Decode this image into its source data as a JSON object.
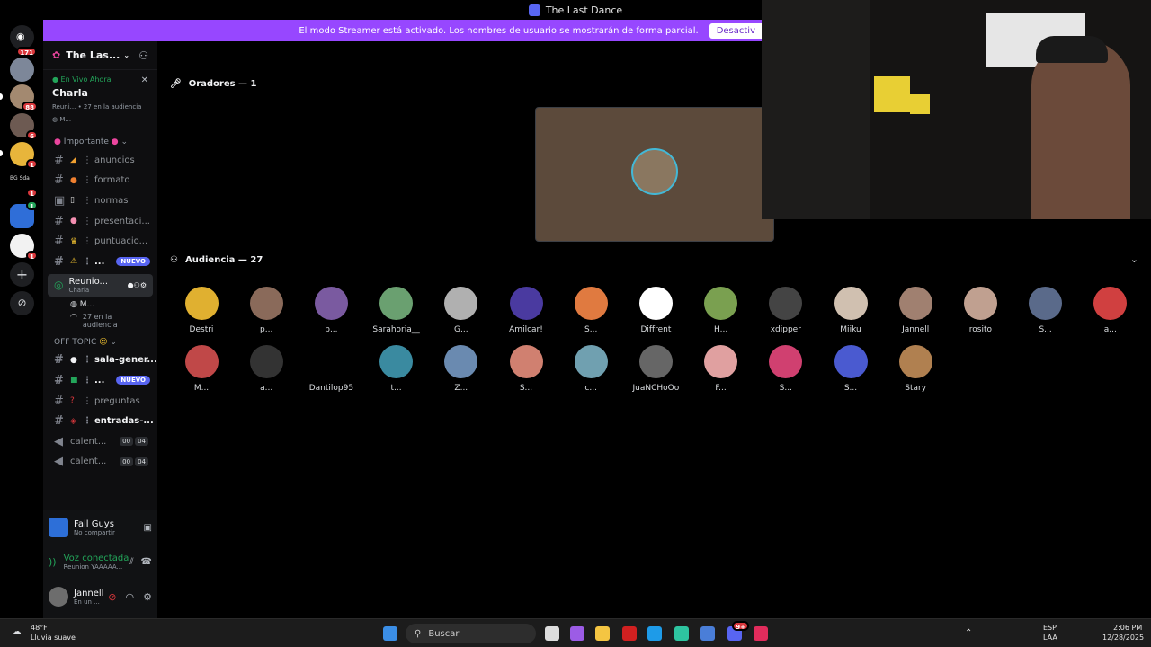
{
  "window": {
    "title": "The Last Dance"
  },
  "banner": {
    "message": "El modo Streamer está activado. Los nombres de usuario se mostrarán de forma parcial.",
    "button": "Desactiv"
  },
  "server_rail": {
    "badges": [
      "171",
      "88",
      "6",
      "1",
      "1",
      "1",
      "1"
    ],
    "folder_label": "BG Sda"
  },
  "sidebar": {
    "server_name": "The Las...",
    "live": {
      "status": "En Vivo Ahora",
      "channel": "Charla",
      "sub": "Reuni... • 27 en la audiencia",
      "user": "M..."
    },
    "categories": [
      "Importante",
      "OFF TOPIC"
    ],
    "channels": [
      {
        "name": "anuncios",
        "icon": "megaphone-emoji"
      },
      {
        "name": "formato",
        "icon": "pill-emoji"
      },
      {
        "name": "normas",
        "icon": "clipboard-emoji"
      },
      {
        "name": "presentaci...",
        "icon": "pig-emoji"
      },
      {
        "name": "puntuacio...",
        "icon": "crown-emoji"
      },
      {
        "name": "...",
        "icon": "warning-emoji",
        "badge": "NUEVO"
      }
    ],
    "stage": {
      "name": "Reunio...",
      "sub": "Charla",
      "user": "M...",
      "audience": "27 en la audiencia"
    },
    "offtopic_channels": [
      {
        "name": "sala-gener...",
        "icon": "speech-emoji",
        "bold": true
      },
      {
        "name": "...",
        "icon": "check-emoji",
        "badge": "NUEVO",
        "bold": true
      },
      {
        "name": "preguntas",
        "icon": "question-emoji"
      },
      {
        "name": "entradas-...",
        "icon": "alarm-emoji",
        "bold": true
      }
    ],
    "voice_channels": [
      {
        "name": "calent...",
        "counts": [
          "00",
          "04"
        ]
      },
      {
        "name": "calent...",
        "counts": [
          "00",
          "04"
        ]
      }
    ]
  },
  "user_panel": {
    "activity": "Fall Guys",
    "activity_sub": "No compartir",
    "voice_status": "Voz conectada",
    "voice_channel": "Reunion YAAAAA...",
    "username": "Jannell",
    "user_status": "En un ..."
  },
  "stage": {
    "speakers_title": "Oradores — 1",
    "audience_title": "Audiencia — 27",
    "audience": [
      "Destri",
      "p...",
      "b...",
      "Sarahoria__",
      "G...",
      "Amilcar!",
      "S...",
      "Diffrent",
      "H...",
      "xdipper",
      "Miiku",
      "Jannell",
      "rosito",
      "S...",
      "a...",
      "M...",
      "a...",
      "Dantilop95",
      "t...",
      "Z...",
      "S...",
      "c...",
      "JuaNCHoOo",
      "F...",
      "S...",
      "S...",
      "Stary"
    ]
  },
  "taskbar": {
    "weather_temp": "48°F",
    "weather_text": "Lluvia suave",
    "search_placeholder": "Buscar",
    "lang": "ESP",
    "lang2": "LAA",
    "time": "2:06 PM",
    "date": "12/28/2025",
    "discord_badge": "9+"
  },
  "colors": {
    "accent": "#5865f2",
    "banner": "#9747ff",
    "online": "#23a55a"
  }
}
